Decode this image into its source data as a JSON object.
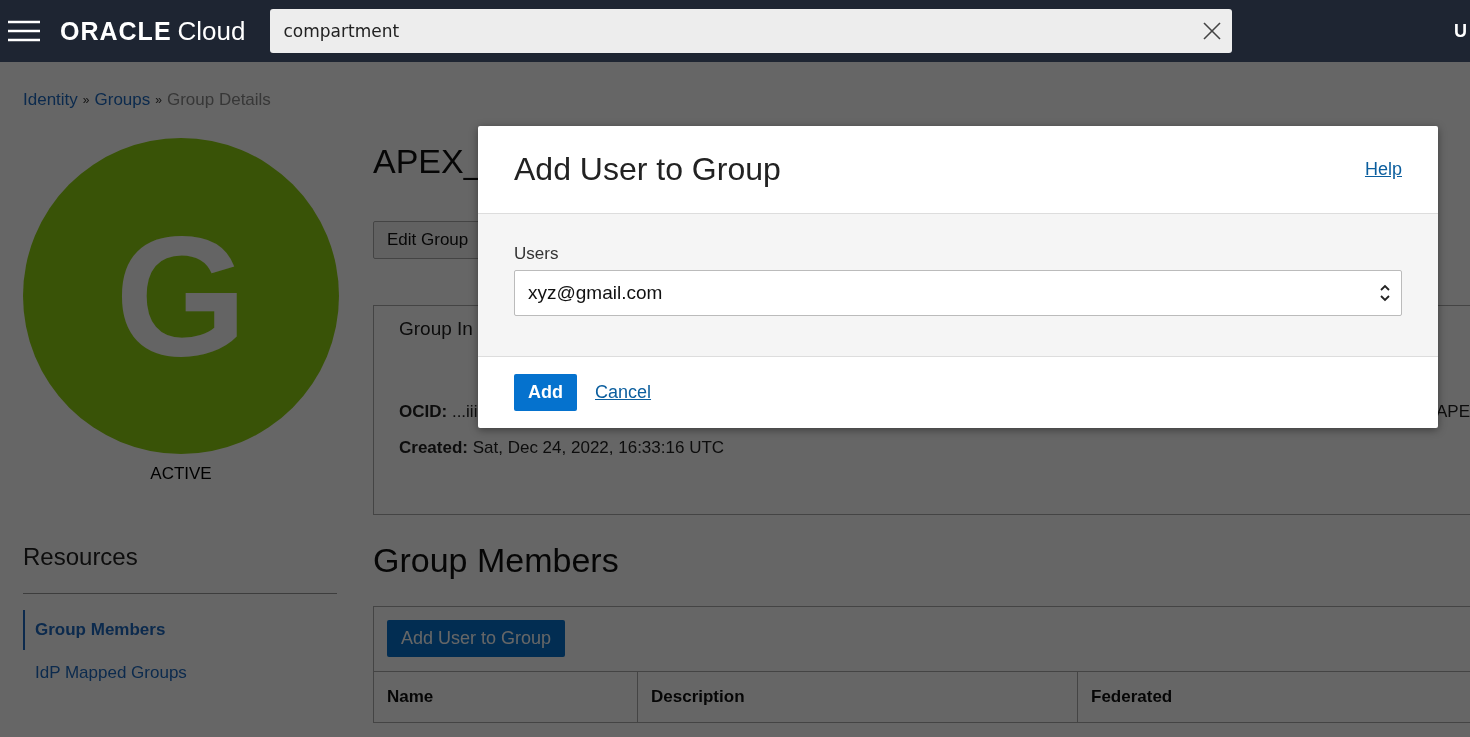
{
  "header": {
    "logo": {
      "brand": "ORACLE",
      "product": "Cloud"
    },
    "search": {
      "value": "compartment"
    },
    "user_initial": "U"
  },
  "breadcrumb": {
    "separator": "»",
    "items": [
      {
        "label": "Identity",
        "link": true
      },
      {
        "label": "Groups",
        "link": true
      },
      {
        "label": "Group Details",
        "link": false
      }
    ]
  },
  "avatar": {
    "letter": "G",
    "status": "ACTIVE"
  },
  "resources": {
    "title": "Resources",
    "items": [
      {
        "label": "Group Members",
        "selected": true
      },
      {
        "label": "IdP Mapped Groups",
        "selected": false
      }
    ]
  },
  "group": {
    "title": "APEX_",
    "buttons": [
      "Edit Group"
    ],
    "info": {
      "title": "Group In",
      "fields": [
        {
          "label": "OCID:",
          "value": "...iii"
        },
        {
          "label": "Created:",
          "value": "Sat, Dec 24, 2022, 16:33:16 UTC"
        }
      ],
      "side_text": "APE"
    }
  },
  "members": {
    "title": "Group Members",
    "button": "Add User to Group",
    "columns": [
      "Name",
      "Description",
      "Federated"
    ]
  },
  "dialog": {
    "title": "Add User to Group",
    "help": "Help",
    "field": {
      "label": "Users",
      "value": "xyz@gmail.com"
    },
    "primary": "Add",
    "cancel": "Cancel"
  }
}
